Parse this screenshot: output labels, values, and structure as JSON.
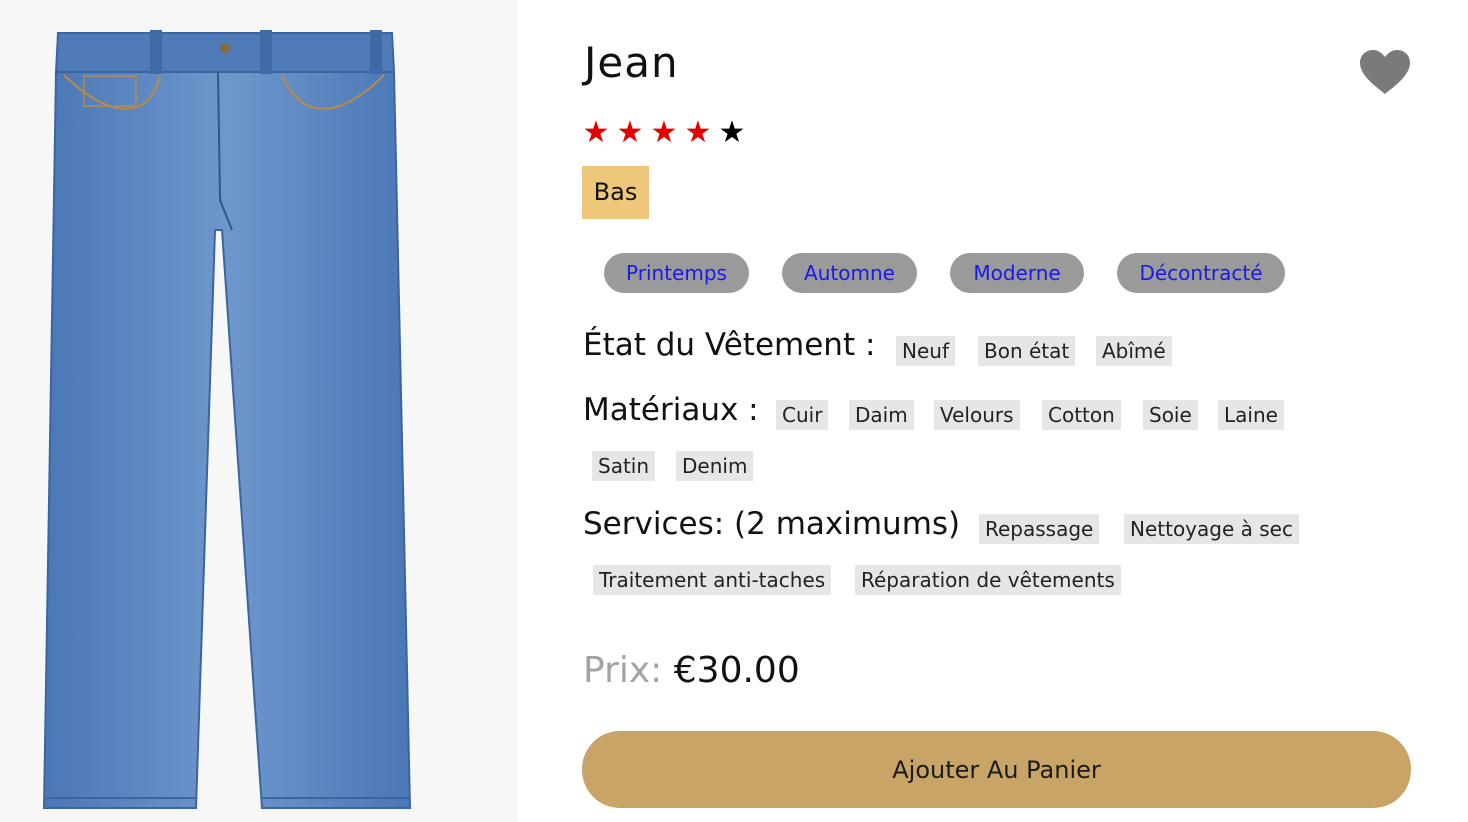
{
  "product": {
    "title": "Jean",
    "image_alt": "jeans",
    "rating": {
      "value": 4,
      "max": 5,
      "filled_color": "#e30000",
      "empty_color": "#000000"
    },
    "category": "Bas",
    "tags": [
      "Printemps",
      "Automne",
      "Moderne",
      "Décontracté"
    ]
  },
  "condition": {
    "label": "État du Vêtement :",
    "options": [
      "Neuf",
      "Bon état",
      "Abîmé"
    ]
  },
  "materials": {
    "label": "Matériaux :",
    "options": [
      "Cuir",
      "Daim",
      "Velours",
      "Cotton",
      "Soie",
      "Laine",
      "Satin",
      "Denim"
    ]
  },
  "services": {
    "label": "Services: (2 maximums)",
    "options": [
      "Repassage",
      "Nettoyage à sec",
      "Traitement anti-taches",
      "Réparation de vêtements"
    ]
  },
  "price": {
    "label": "Prix:",
    "value": "€30.00"
  },
  "cart_button": {
    "label": "Ajouter Au Panier"
  },
  "icons": {
    "favorite": "heart-icon",
    "star": "star-icon"
  },
  "colors": {
    "accent": "#c8a566",
    "category_bg": "#eec77a",
    "tag_bg": "#9a9a9a",
    "tag_text": "#1a1ae6",
    "heart": "#7a7a7a"
  }
}
